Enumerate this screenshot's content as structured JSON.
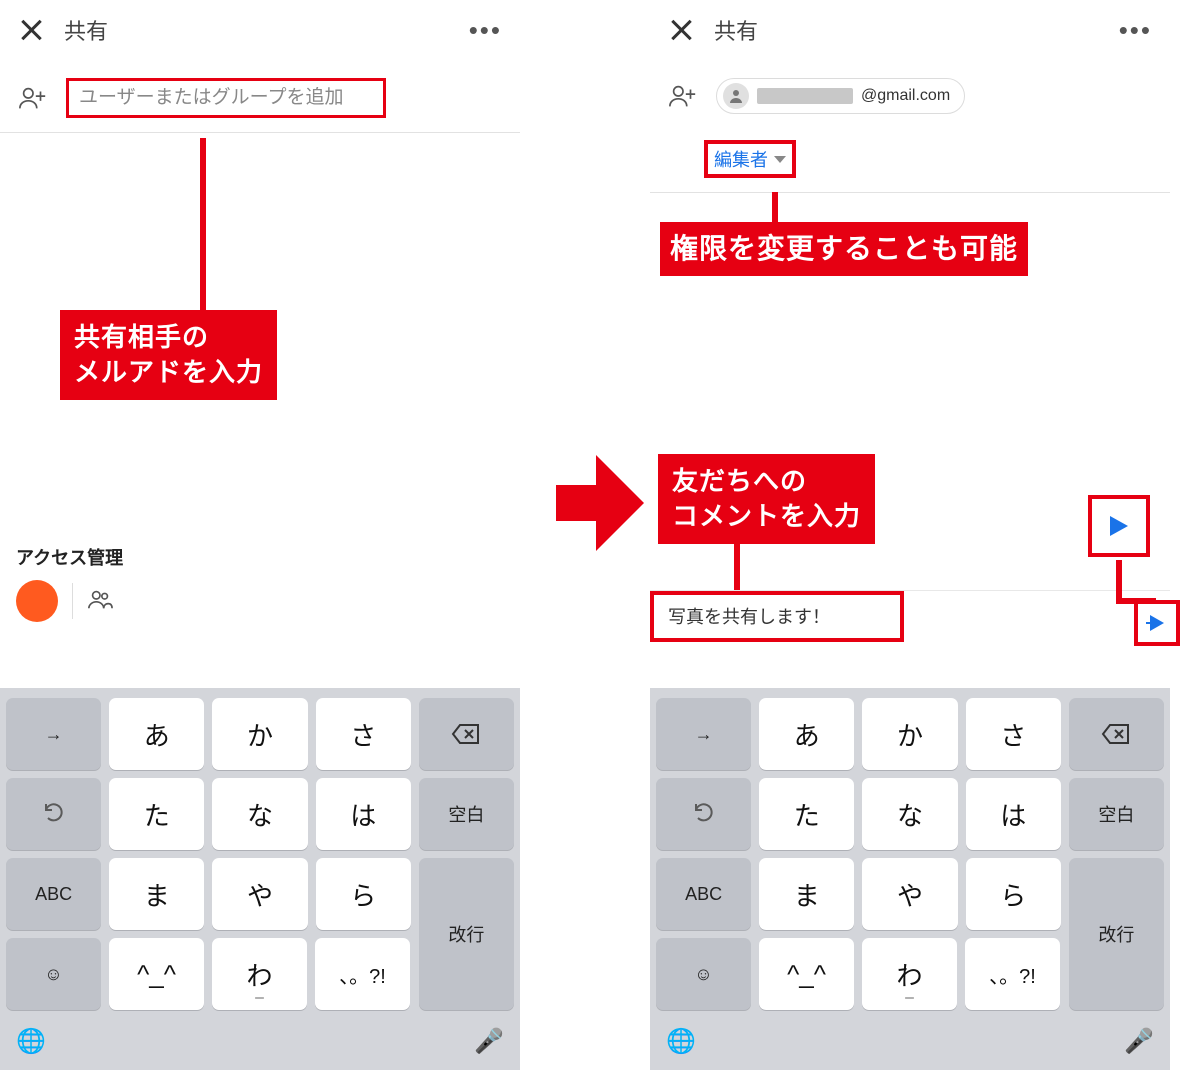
{
  "left": {
    "title": "共有",
    "more": "•••",
    "input_placeholder": "ユーザーまたはグループを追加",
    "callout": "共有相手の\nメルアドを入力",
    "access_title": "アクセス管理"
  },
  "right": {
    "title": "共有",
    "more": "•••",
    "chip_domain": "@gmail.com",
    "role_label": "編集者",
    "role_callout": "権限を変更することも可能",
    "comment_callout": "友だちへの\nコメントを入力",
    "message_value": "写真を共有します！"
  },
  "keyboard": {
    "rows": [
      [
        "→",
        "あ",
        "か",
        "さ",
        "DEL"
      ],
      [
        "UNDO",
        "た",
        "な",
        "は",
        "空白"
      ],
      [
        "ABC",
        "ま",
        "や",
        "ら",
        "改行TOP"
      ],
      [
        "☺",
        "^_^",
        "わ",
        "、。?!",
        "改行BOT"
      ]
    ],
    "space_label": "空白",
    "abc_label": "ABC",
    "kaigyou_label": "改行",
    "arrow_label": "→",
    "wa_sub": "ー",
    "punct_label": "、。?!",
    "emo_label": "^_^",
    "globe": "🌐",
    "mic": "🎤"
  }
}
